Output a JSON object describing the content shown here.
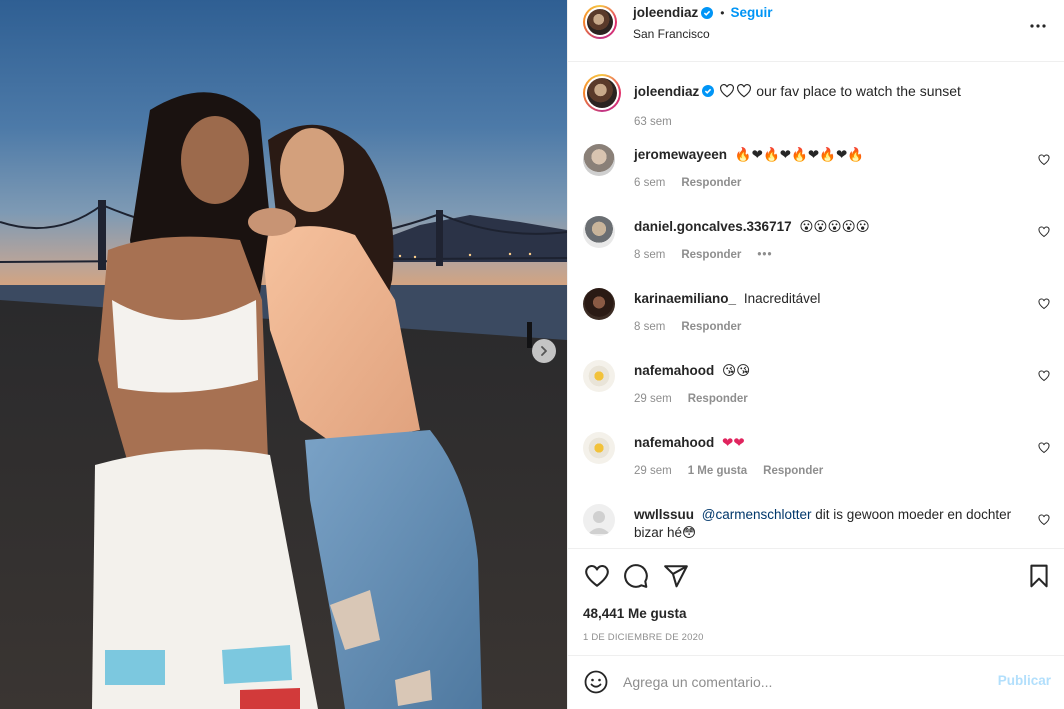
{
  "post": {
    "author": "joleendiaz",
    "follow_label": "Seguir",
    "separator": "•",
    "location": "San Francisco",
    "caption": "our fav place to watch the sunset",
    "caption_time": "63 sem",
    "likes": "48,441 Me gusta",
    "date": "1 de diciembre de 2020"
  },
  "comments": [
    {
      "user": "jeromewayeen",
      "text": "🔥❤🔥❤🔥❤🔥❤🔥",
      "time": "6 sem",
      "reply": "Responder",
      "likes": "",
      "avatar": "avatar-jerome"
    },
    {
      "user": "daniel.goncalves.336717",
      "text": "😮😮😮😮😮",
      "time": "8 sem",
      "reply": "Responder",
      "likes": "",
      "options": "•••",
      "avatar": "avatar-daniel"
    },
    {
      "user": "karinaemiliano_",
      "text": "Inacreditável",
      "time": "8 sem",
      "reply": "Responder",
      "likes": "",
      "avatar": "avatar-karina"
    },
    {
      "user": "nafemahood",
      "text": "😘😘",
      "time": "29 sem",
      "reply": "Responder",
      "likes": "",
      "avatar": "avatar-nafe"
    },
    {
      "user": "nafemahood",
      "text": "❤❤",
      "time": "29 sem",
      "reply": "Responder",
      "likes": "1 Me gusta",
      "avatar": "avatar-nafe"
    },
    {
      "user": "wwllssuu",
      "mention": "@carmenschlotter",
      "text": "dit is gewoon moeder en dochter bizar hé😳",
      "time": "",
      "reply": "",
      "likes": "",
      "avatar": "avatar-default"
    }
  ],
  "composer": {
    "placeholder": "Agrega un comentario...",
    "post_label": "Publicar"
  },
  "icons": {
    "like": "heart-outline-icon",
    "comment": "speech-bubble-icon",
    "share": "paper-plane-icon",
    "save": "bookmark-icon",
    "emoji": "smiley-icon",
    "more": "more-dots-icon",
    "next": "chevron-right-icon",
    "verified": "verified-badge-icon"
  },
  "colors": {
    "link": "#0095f6",
    "mention": "#00376b",
    "muted": "#8e8e8e",
    "post_disabled": "#b2dffc"
  }
}
